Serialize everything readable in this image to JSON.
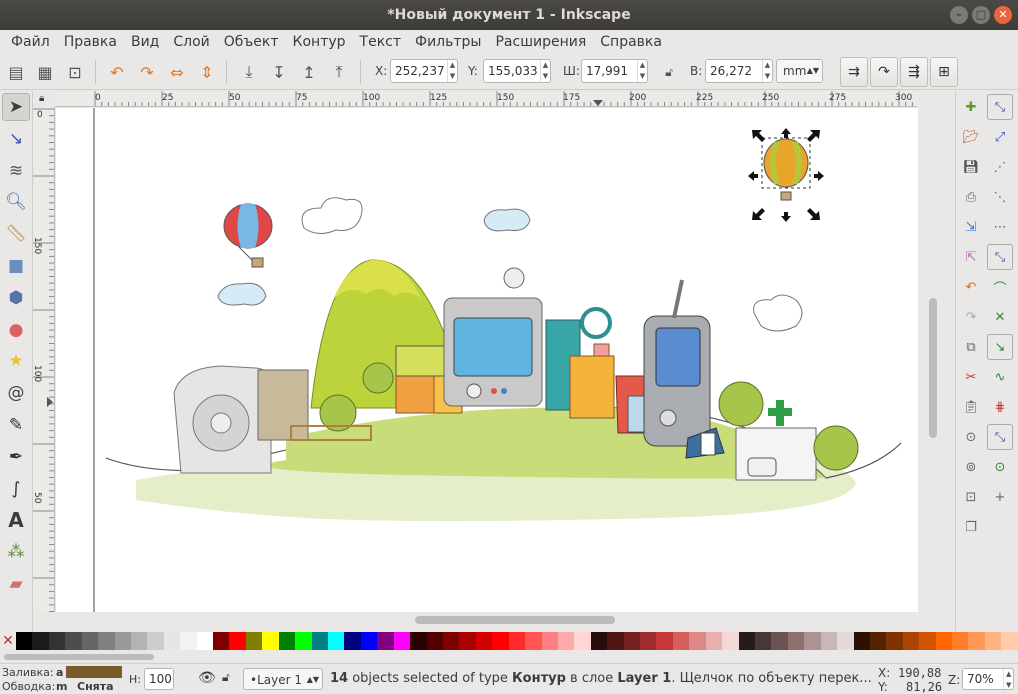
{
  "window": {
    "title": "*Новый документ 1 - Inkscape"
  },
  "menu": [
    "Файл",
    "Правка",
    "Вид",
    "Слой",
    "Объект",
    "Контур",
    "Текст",
    "Фильтры",
    "Расширения",
    "Справка"
  ],
  "toolbar": {
    "x_label": "X:",
    "x_value": "252,237",
    "y_label": "Y:",
    "y_value": "155,033",
    "w_label": "Ш:",
    "w_value": "17,991",
    "h_label": "В:",
    "h_value": "26,272",
    "unit": "mm"
  },
  "ruler": {
    "h_ticks": [
      "0",
      "25",
      "50",
      "75",
      "100",
      "125",
      "150",
      "175",
      "200",
      "225",
      "250",
      "275",
      "300"
    ],
    "v_ticks": [
      "0",
      "150",
      "100",
      "50"
    ]
  },
  "palette": [
    "#000000",
    "#1a1a1a",
    "#333333",
    "#4d4d4d",
    "#666666",
    "#808080",
    "#999999",
    "#b3b3b3",
    "#cccccc",
    "#e6e6e6",
    "#f2f2f2",
    "#ffffff",
    "#800000",
    "#ff0000",
    "#808000",
    "#ffff00",
    "#008000",
    "#00ff00",
    "#008080",
    "#00ffff",
    "#000080",
    "#0000ff",
    "#800080",
    "#ff00ff",
    "#2b0000",
    "#550000",
    "#800000",
    "#aa0000",
    "#d40000",
    "#ff0000",
    "#ff2a2a",
    "#ff5555",
    "#ff8080",
    "#ffaaaa",
    "#ffd5d5",
    "#280b0b",
    "#501616",
    "#782121",
    "#a02c2c",
    "#c83737",
    "#d35f5f",
    "#de8787",
    "#e9afaf",
    "#f4d7d7",
    "#241c1c",
    "#483737",
    "#6c5353",
    "#916f6f",
    "#ac9393",
    "#c8b7b7",
    "#e3dbdb",
    "#2b1100",
    "#552200",
    "#803300",
    "#aa4400",
    "#d45500",
    "#ff6600",
    "#ff7f2a",
    "#ff9955",
    "#ffb380",
    "#ffccaa"
  ],
  "status": {
    "fill_label": "Заливка:",
    "fill_value": "a",
    "fill_color": "#7a5a2a",
    "stroke_label": "Обводка:",
    "stroke_value": "m",
    "stroke_state": "Снята",
    "h_label": "H:",
    "h_value": "100",
    "layer": "•Layer 1",
    "msg_count": "14",
    "msg_a": " objects selected of type ",
    "msg_type": "Контур",
    "msg_b": " в слое ",
    "msg_layer": "Layer 1",
    "msg_c": ". Щелчок по объекту перек...",
    "x_label": "X:",
    "x_value": "190,88",
    "y_label": "Y:",
    "y_value": "81,26",
    "z_label": "Z:",
    "zoom": "70%"
  }
}
